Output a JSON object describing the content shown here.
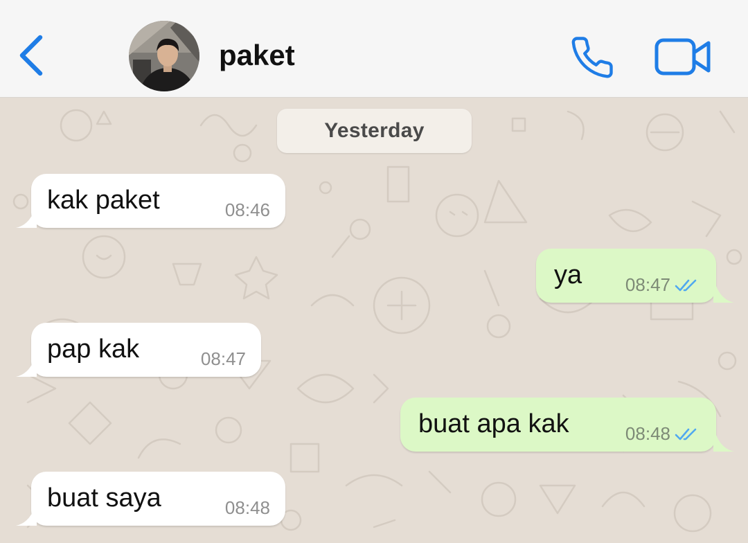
{
  "header": {
    "back_icon": "chevron-left-icon",
    "contact_name": "paket",
    "call_icon": "phone-icon",
    "video_icon": "video-camera-icon"
  },
  "chat": {
    "date_separator": "Yesterday",
    "messages": [
      {
        "direction": "incoming",
        "text": "kak paket",
        "time": "08:46"
      },
      {
        "direction": "outgoing",
        "text": "ya",
        "time": "08:47",
        "status": "read"
      },
      {
        "direction": "incoming",
        "text": "pap kak",
        "time": "08:47"
      },
      {
        "direction": "outgoing",
        "text": "buat apa kak",
        "time": "08:48",
        "status": "read"
      },
      {
        "direction": "incoming",
        "text": "buat saya",
        "time": "08:48"
      }
    ]
  },
  "colors": {
    "accent_blue": "#1f7de6",
    "header_bg": "#f6f6f6",
    "chat_bg": "#e5ddd4",
    "incoming_bubble": "#ffffff",
    "outgoing_bubble": "#dcf8c6",
    "read_tick": "#4fa8f0"
  }
}
